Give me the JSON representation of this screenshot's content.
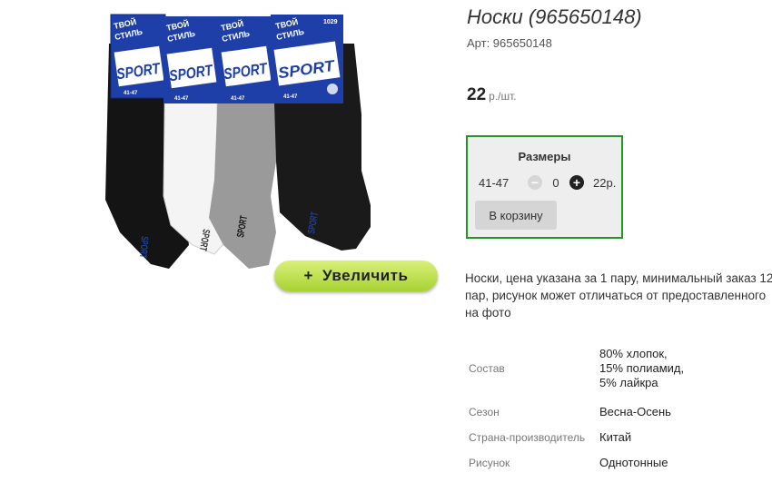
{
  "product": {
    "title": "Носки (965650148)",
    "article": "Арт: 965650148",
    "price_amount": "22",
    "price_unit": "р./шт.",
    "image_alt": "Носки SPORT",
    "zoom_label": "Увеличить",
    "zoom_plus": "+",
    "image_text": {
      "brand_line1": "ТВОЙ",
      "brand_line2": "СТИЛЬ",
      "sport": "SPORT",
      "size": "41-47",
      "code": "1029",
      "side_print": "SPORT"
    }
  },
  "sizes": {
    "heading": "Размеры",
    "rows": [
      {
        "label": "41-47",
        "minus": "−",
        "quantity": "0",
        "plus": "+",
        "price": "22р."
      }
    ],
    "cart_label": "В корзину"
  },
  "description": "Носки, цена указана за 1 пару, минимальный заказ 12 пар, рисунок может отличаться от предоставленного на фото",
  "specs": [
    {
      "name": "Состав",
      "value": "80% хлопок, 15% полиамид, 5% лайкра"
    },
    {
      "name": "Сезон",
      "value": "Весна-Осень"
    },
    {
      "name": "Страна-производитель",
      "value": "Китай"
    },
    {
      "name": "Рисунок",
      "value": "Однотонные"
    }
  ],
  "colors": {
    "accent_green": "#1f9a1f",
    "zoom_button": "#b9de4a",
    "package_blue": "#1f3fa8"
  }
}
